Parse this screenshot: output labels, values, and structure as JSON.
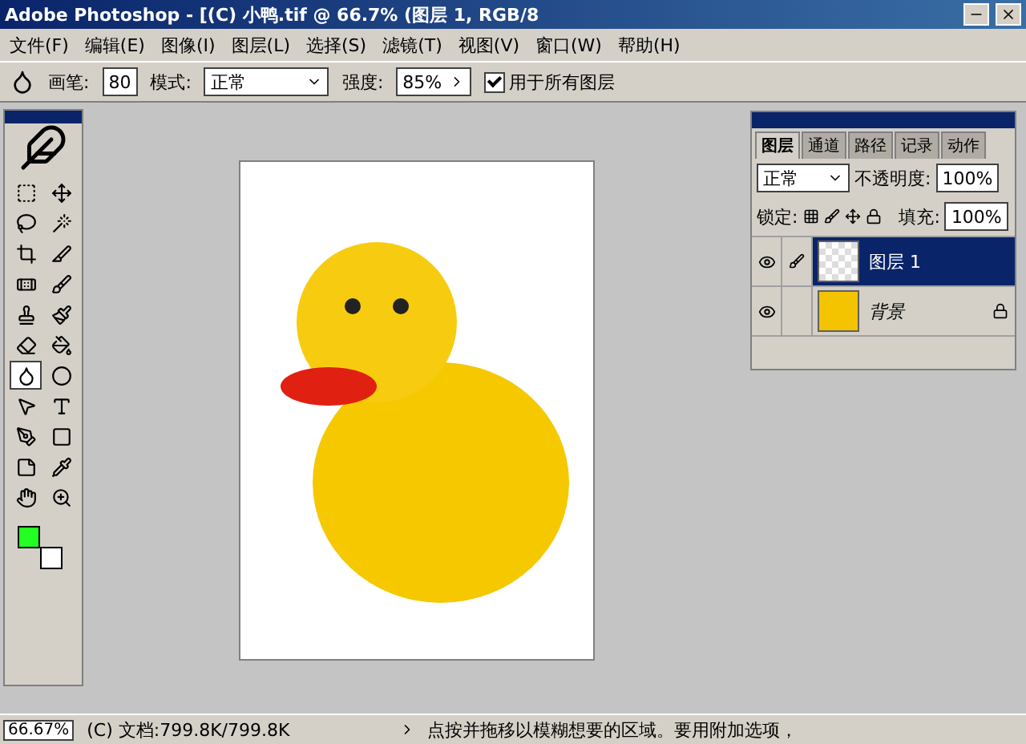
{
  "window": {
    "title": "Adobe Photoshop - [(C) 小鸭.tif @ 66.7% (图层 1, RGB/8"
  },
  "menu": [
    "文件(F)",
    "编辑(E)",
    "图像(I)",
    "图层(L)",
    "选择(S)",
    "滤镜(T)",
    "视图(V)",
    "窗口(W)",
    "帮助(H)"
  ],
  "options": {
    "brush_label": "画笔:",
    "brush_size": "80",
    "mode_label": "模式:",
    "mode": "正常",
    "strength_label": "强度:",
    "strength": "85%",
    "all_layers": {
      "label": "用于所有图层",
      "checked": true
    }
  },
  "tools": [
    {
      "selected": false
    },
    {
      "selected": false
    },
    {
      "selected": false
    },
    {
      "selected": false
    },
    {
      "selected": false
    },
    {
      "selected": false
    },
    {
      "selected": false
    },
    {
      "selected": false
    },
    {
      "selected": false
    },
    {
      "selected": false
    },
    {
      "selected": false
    },
    {
      "selected": false
    },
    {
      "selected": true
    },
    {
      "selected": false
    },
    {
      "selected": false
    },
    {
      "selected": false
    },
    {
      "selected": false
    },
    {
      "selected": false
    },
    {
      "selected": false
    },
    {
      "selected": false
    },
    {
      "selected": false
    },
    {
      "selected": false
    }
  ],
  "swatches": [
    {
      "color": "#22ff22"
    },
    {
      "color": "#ffffff"
    }
  ],
  "layers_panel": {
    "tabs": [
      {
        "label": "图层",
        "selected": true
      },
      {
        "label": "通道",
        "selected": false
      },
      {
        "label": "路径",
        "selected": false
      },
      {
        "label": "记录",
        "selected": false
      },
      {
        "label": "动作",
        "selected": false
      }
    ],
    "blend_mode": "正常",
    "opacity_label": "不透明度:",
    "opacity": "100%",
    "lock_label": "锁定:",
    "fill_label": "填充:",
    "fill": "100%",
    "layers": [
      {
        "name": "图层 1",
        "selected": true,
        "visible": true,
        "kind": "transparent",
        "locked": false
      },
      {
        "name": "背景",
        "selected": false,
        "visible": true,
        "kind": "image",
        "locked": true
      }
    ]
  },
  "status_bar": {
    "zoom": "66.67%",
    "doc": "(C) 文档:799.8K/799.8K",
    "hint": "点按并拖移以模糊想要的区域。要用附加选项，"
  }
}
